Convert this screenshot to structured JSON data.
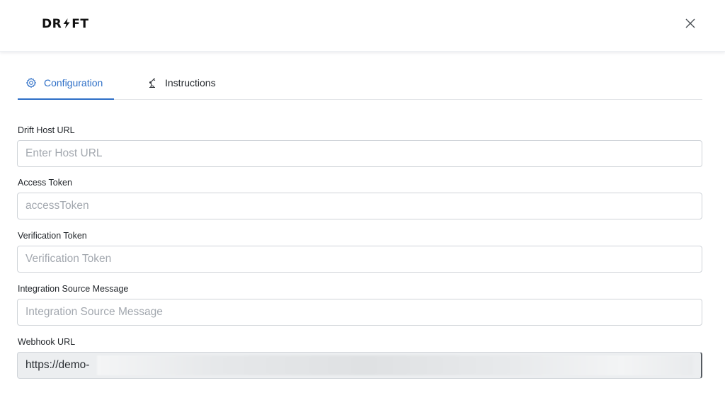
{
  "header": {
    "logo_text": "DR⚡FT",
    "close_icon": "close-icon"
  },
  "tabs": [
    {
      "label": "Configuration",
      "icon": "gear-icon",
      "active": true
    },
    {
      "label": "Instructions",
      "icon": "robot-arm-icon",
      "active": false
    }
  ],
  "colors": {
    "accent": "#2e6fc7",
    "input_border": "#cfd3d8",
    "placeholder": "#a3a8af",
    "disabled_bg": "#eceef0"
  },
  "form": {
    "host_url": {
      "label": "Drift Host URL",
      "placeholder": "Enter Host URL",
      "value": ""
    },
    "access_token": {
      "label": "Access Token",
      "placeholder": "accessToken",
      "value": ""
    },
    "verification_token": {
      "label": "Verification Token",
      "placeholder": "Verification Token",
      "value": ""
    },
    "integration_source_message": {
      "label": "Integration Source Message",
      "placeholder": "Integration Source Message",
      "value": ""
    },
    "webhook_url": {
      "label": "Webhook URL",
      "value": "https://demo-"
    }
  }
}
